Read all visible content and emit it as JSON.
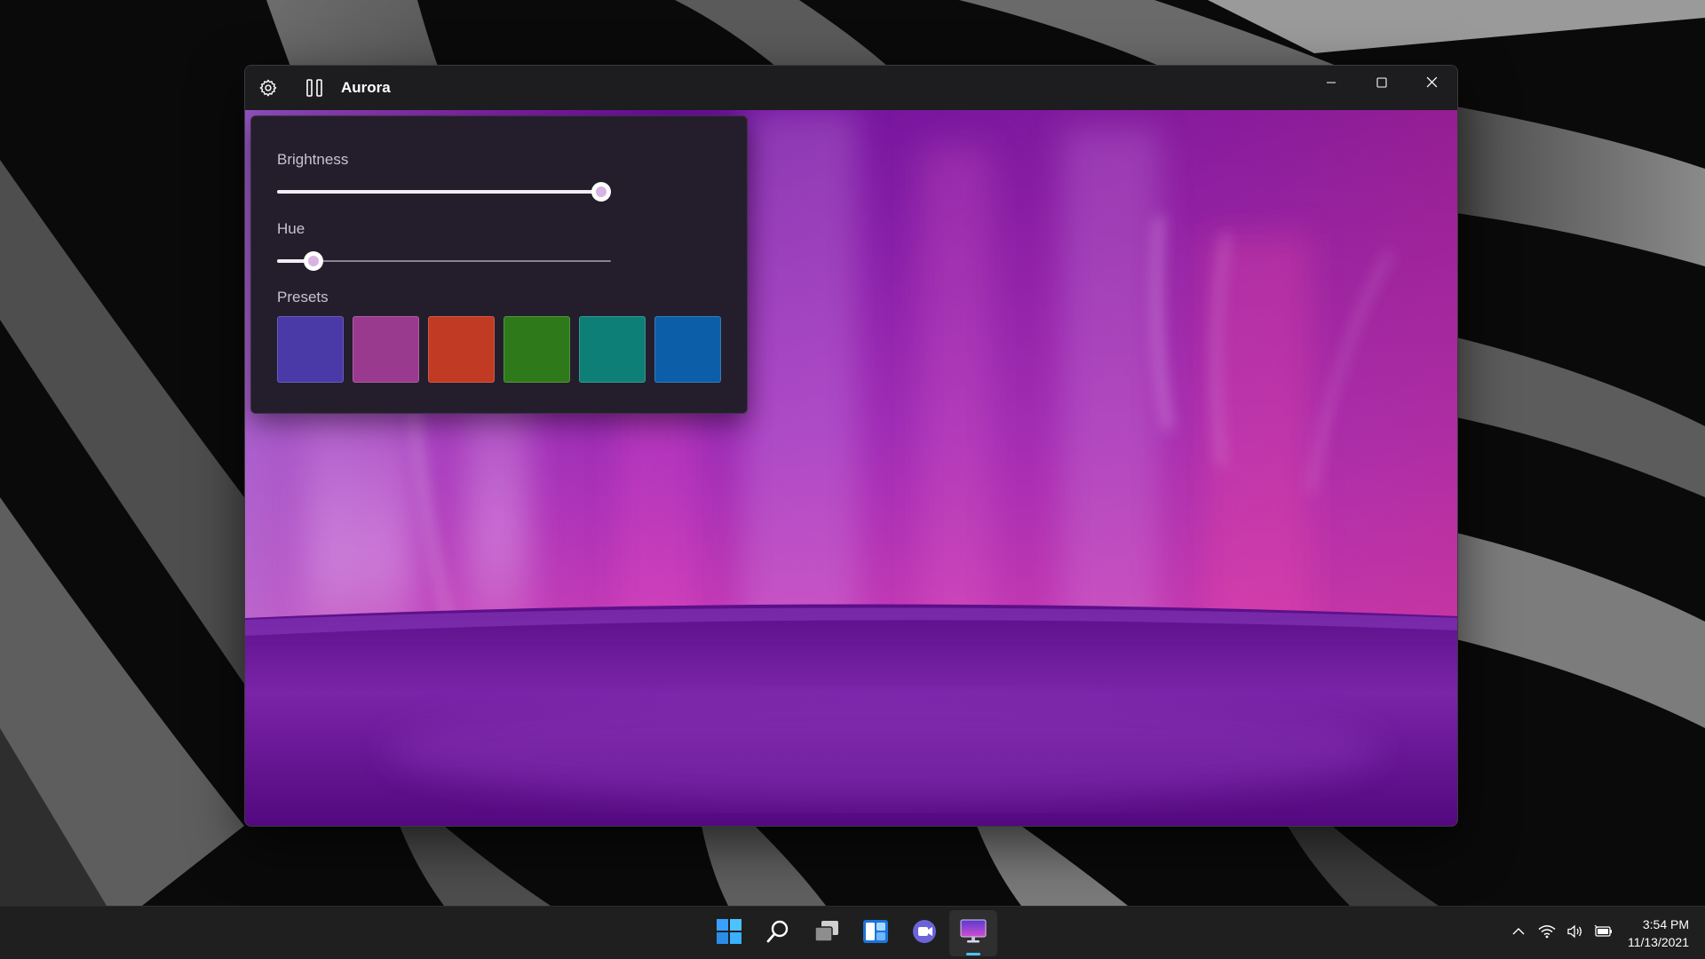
{
  "window": {
    "title": "Aurora",
    "toolbar_icons": [
      "gear-icon",
      "pause-icon"
    ],
    "caption_icons": [
      "minimize-icon",
      "maximize-icon",
      "close-icon"
    ]
  },
  "settings_panel": {
    "brightness": {
      "label": "Brightness",
      "value": 0.97
    },
    "hue": {
      "label": "Hue",
      "value": 0.11
    },
    "presets": {
      "label": "Presets",
      "colors": [
        "#4a3aa8",
        "#9a3a8e",
        "#c03a24",
        "#2e7a1a",
        "#0e7f76",
        "#0c5ea9"
      ]
    }
  },
  "colors": {
    "accent": "#4cc2ff",
    "aurora_purple": "#7a1fa8",
    "aurora_pink": "#d43fb8"
  },
  "taskbar": {
    "apps": [
      "windows-start-icon",
      "search-icon",
      "task-view-icon",
      "widgets-icon",
      "teams-chat-icon",
      "aurora-app-icon"
    ],
    "active_app": "aurora-app-icon",
    "tray_icons": [
      "chevron-up-icon",
      "wifi-icon",
      "volume-icon",
      "battery-icon"
    ],
    "time": "3:54 PM",
    "date": "11/13/2021"
  }
}
